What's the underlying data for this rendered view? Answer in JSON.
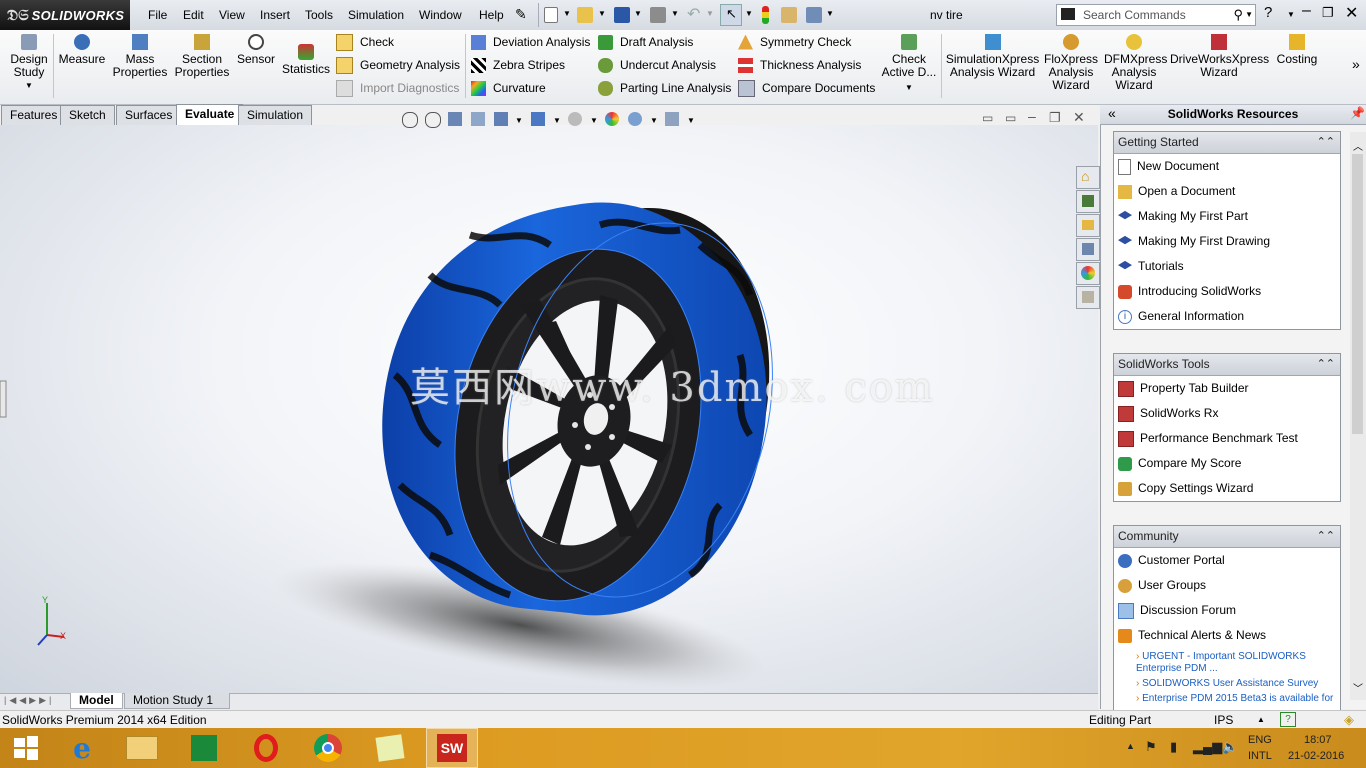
{
  "app": {
    "brand": "SOLIDWORKS",
    "doc_title": "nv tire"
  },
  "menu": [
    "File",
    "Edit",
    "View",
    "Insert",
    "Tools",
    "Simulation",
    "Window",
    "Help"
  ],
  "search": {
    "placeholder": "Search Commands"
  },
  "ribbon": {
    "big_left": [
      "Design\nStudy",
      "Measure",
      "Mass\nProperties",
      "Section\nProperties",
      "Sensor",
      "Statistics"
    ],
    "col1": [
      "Check",
      "Geometry Analysis",
      "Import Diagnostics"
    ],
    "col2": [
      "Deviation Analysis",
      "Zebra Stripes",
      "Curvature"
    ],
    "col3": [
      "Draft Analysis",
      "Undercut Analysis",
      "Parting Line Analysis"
    ],
    "col4": [
      "Symmetry Check",
      "Thickness Analysis",
      "Compare Documents"
    ],
    "check_active": "Check\nActive D...",
    "big_right": [
      "SimulationXpress\nAnalysis Wizard",
      "FloXpress\nAnalysis\nWizard",
      "DFMXpress\nAnalysis\nWizard",
      "DriveWorksXpress\nWizard",
      "Costing"
    ]
  },
  "cm_tabs": [
    "Features",
    "Sketch",
    "Surfaces",
    "Evaluate",
    "Simulation"
  ],
  "cm_active": "Evaluate",
  "watermark": "莫西网www. 3dmox. com",
  "model_tabs": [
    "Model",
    "Motion Study 1"
  ],
  "status": {
    "left": "SolidWorks Premium 2014 x64 Edition",
    "mode": "Editing Part",
    "units": "IPS"
  },
  "taskpane": {
    "title": "SolidWorks Resources",
    "getting_started": {
      "header": "Getting Started",
      "items": [
        "New Document",
        "Open a Document",
        "Making My First Part",
        "Making My First Drawing",
        "Tutorials",
        "Introducing SolidWorks",
        "General Information"
      ]
    },
    "tools": {
      "header": "SolidWorks Tools",
      "items": [
        "Property Tab Builder",
        "SolidWorks Rx",
        "Performance Benchmark Test",
        "Compare My Score",
        "Copy Settings Wizard"
      ]
    },
    "community": {
      "header": "Community",
      "items": [
        "Customer Portal",
        "User Groups",
        "Discussion Forum",
        "Technical Alerts & News"
      ],
      "news": [
        "URGENT - Important SOLIDWORKS Enterprise PDM ...",
        "SOLIDWORKS User Assistance Survey",
        "Enterprise PDM 2015 Beta3 is available for"
      ]
    }
  },
  "tray": {
    "lang1": "ENG",
    "lang2": "INTL",
    "time": "18:07",
    "date": "21-02-2016"
  },
  "colors": {
    "tire_blue": "#1a63d8",
    "rim": "#1b1b1d",
    "taskbar": "#d8962a"
  }
}
